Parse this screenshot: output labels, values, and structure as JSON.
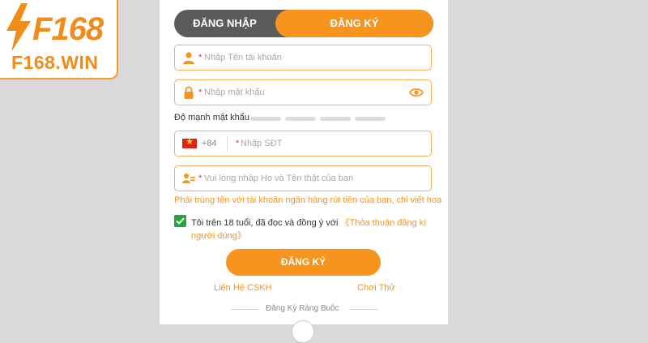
{
  "logo": {
    "main": "F168",
    "sub": "F168.WIN"
  },
  "tabs": {
    "login": "ĐĂNG NHẬP",
    "register": "ĐĂNG KÝ"
  },
  "form": {
    "username_placeholder": "Nhập Tên tài khoản",
    "password_placeholder": "Nhập mật khẩu",
    "strength_label": "Độ mạnh mật khẩu",
    "country_code": "+84",
    "phone_placeholder": "Nhập SĐT",
    "fullname_placeholder": "Vui lòng nhập Họ và Tên thật của bạn",
    "hint": "Phải trùng tên với tài khoản ngân hàng rút tiền của bạn, chỉ viết hoa",
    "agree_text": "Tôi trên 18 tuổi, đã đọc và đồng ý với",
    "agree_link_1": "《Thỏa thuận đăng kí",
    "agree_link_2": "người dùng》",
    "required_mark": "*",
    "submit": "ĐĂNG KÝ"
  },
  "links": {
    "support": "Liên Hệ CSKH",
    "trial": "Chơi Thử"
  },
  "footer": {
    "text": "Đăng Ký Ràng Buộc"
  },
  "colors": {
    "accent": "#f7941d",
    "tab_inactive": "#5b5b5b",
    "check": "#22a63a",
    "required": "#e5302f"
  }
}
